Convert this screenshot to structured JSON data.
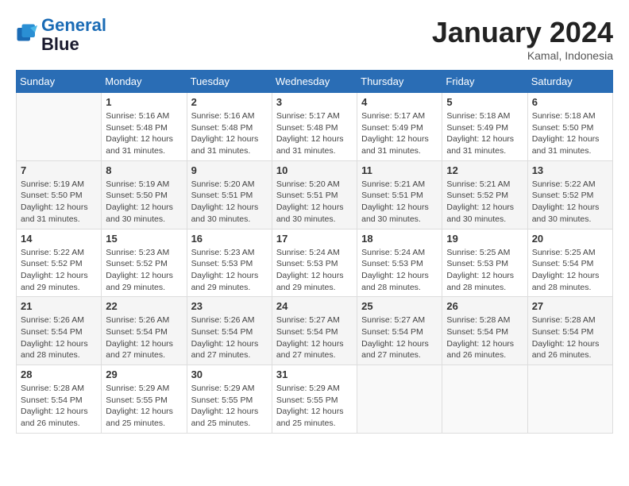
{
  "logo": {
    "line1": "General",
    "line2": "Blue"
  },
  "title": "January 2024",
  "location": "Kamal, Indonesia",
  "days_header": [
    "Sunday",
    "Monday",
    "Tuesday",
    "Wednesday",
    "Thursday",
    "Friday",
    "Saturday"
  ],
  "weeks": [
    [
      {
        "num": "",
        "info": ""
      },
      {
        "num": "1",
        "info": "Sunrise: 5:16 AM\nSunset: 5:48 PM\nDaylight: 12 hours\nand 31 minutes."
      },
      {
        "num": "2",
        "info": "Sunrise: 5:16 AM\nSunset: 5:48 PM\nDaylight: 12 hours\nand 31 minutes."
      },
      {
        "num": "3",
        "info": "Sunrise: 5:17 AM\nSunset: 5:48 PM\nDaylight: 12 hours\nand 31 minutes."
      },
      {
        "num": "4",
        "info": "Sunrise: 5:17 AM\nSunset: 5:49 PM\nDaylight: 12 hours\nand 31 minutes."
      },
      {
        "num": "5",
        "info": "Sunrise: 5:18 AM\nSunset: 5:49 PM\nDaylight: 12 hours\nand 31 minutes."
      },
      {
        "num": "6",
        "info": "Sunrise: 5:18 AM\nSunset: 5:50 PM\nDaylight: 12 hours\nand 31 minutes."
      }
    ],
    [
      {
        "num": "7",
        "info": "Sunrise: 5:19 AM\nSunset: 5:50 PM\nDaylight: 12 hours\nand 31 minutes."
      },
      {
        "num": "8",
        "info": "Sunrise: 5:19 AM\nSunset: 5:50 PM\nDaylight: 12 hours\nand 30 minutes."
      },
      {
        "num": "9",
        "info": "Sunrise: 5:20 AM\nSunset: 5:51 PM\nDaylight: 12 hours\nand 30 minutes."
      },
      {
        "num": "10",
        "info": "Sunrise: 5:20 AM\nSunset: 5:51 PM\nDaylight: 12 hours\nand 30 minutes."
      },
      {
        "num": "11",
        "info": "Sunrise: 5:21 AM\nSunset: 5:51 PM\nDaylight: 12 hours\nand 30 minutes."
      },
      {
        "num": "12",
        "info": "Sunrise: 5:21 AM\nSunset: 5:52 PM\nDaylight: 12 hours\nand 30 minutes."
      },
      {
        "num": "13",
        "info": "Sunrise: 5:22 AM\nSunset: 5:52 PM\nDaylight: 12 hours\nand 30 minutes."
      }
    ],
    [
      {
        "num": "14",
        "info": "Sunrise: 5:22 AM\nSunset: 5:52 PM\nDaylight: 12 hours\nand 29 minutes."
      },
      {
        "num": "15",
        "info": "Sunrise: 5:23 AM\nSunset: 5:52 PM\nDaylight: 12 hours\nand 29 minutes."
      },
      {
        "num": "16",
        "info": "Sunrise: 5:23 AM\nSunset: 5:53 PM\nDaylight: 12 hours\nand 29 minutes."
      },
      {
        "num": "17",
        "info": "Sunrise: 5:24 AM\nSunset: 5:53 PM\nDaylight: 12 hours\nand 29 minutes."
      },
      {
        "num": "18",
        "info": "Sunrise: 5:24 AM\nSunset: 5:53 PM\nDaylight: 12 hours\nand 28 minutes."
      },
      {
        "num": "19",
        "info": "Sunrise: 5:25 AM\nSunset: 5:53 PM\nDaylight: 12 hours\nand 28 minutes."
      },
      {
        "num": "20",
        "info": "Sunrise: 5:25 AM\nSunset: 5:54 PM\nDaylight: 12 hours\nand 28 minutes."
      }
    ],
    [
      {
        "num": "21",
        "info": "Sunrise: 5:26 AM\nSunset: 5:54 PM\nDaylight: 12 hours\nand 28 minutes."
      },
      {
        "num": "22",
        "info": "Sunrise: 5:26 AM\nSunset: 5:54 PM\nDaylight: 12 hours\nand 27 minutes."
      },
      {
        "num": "23",
        "info": "Sunrise: 5:26 AM\nSunset: 5:54 PM\nDaylight: 12 hours\nand 27 minutes."
      },
      {
        "num": "24",
        "info": "Sunrise: 5:27 AM\nSunset: 5:54 PM\nDaylight: 12 hours\nand 27 minutes."
      },
      {
        "num": "25",
        "info": "Sunrise: 5:27 AM\nSunset: 5:54 PM\nDaylight: 12 hours\nand 27 minutes."
      },
      {
        "num": "26",
        "info": "Sunrise: 5:28 AM\nSunset: 5:54 PM\nDaylight: 12 hours\nand 26 minutes."
      },
      {
        "num": "27",
        "info": "Sunrise: 5:28 AM\nSunset: 5:54 PM\nDaylight: 12 hours\nand 26 minutes."
      }
    ],
    [
      {
        "num": "28",
        "info": "Sunrise: 5:28 AM\nSunset: 5:54 PM\nDaylight: 12 hours\nand 26 minutes."
      },
      {
        "num": "29",
        "info": "Sunrise: 5:29 AM\nSunset: 5:55 PM\nDaylight: 12 hours\nand 25 minutes."
      },
      {
        "num": "30",
        "info": "Sunrise: 5:29 AM\nSunset: 5:55 PM\nDaylight: 12 hours\nand 25 minutes."
      },
      {
        "num": "31",
        "info": "Sunrise: 5:29 AM\nSunset: 5:55 PM\nDaylight: 12 hours\nand 25 minutes."
      },
      {
        "num": "",
        "info": ""
      },
      {
        "num": "",
        "info": ""
      },
      {
        "num": "",
        "info": ""
      }
    ]
  ]
}
